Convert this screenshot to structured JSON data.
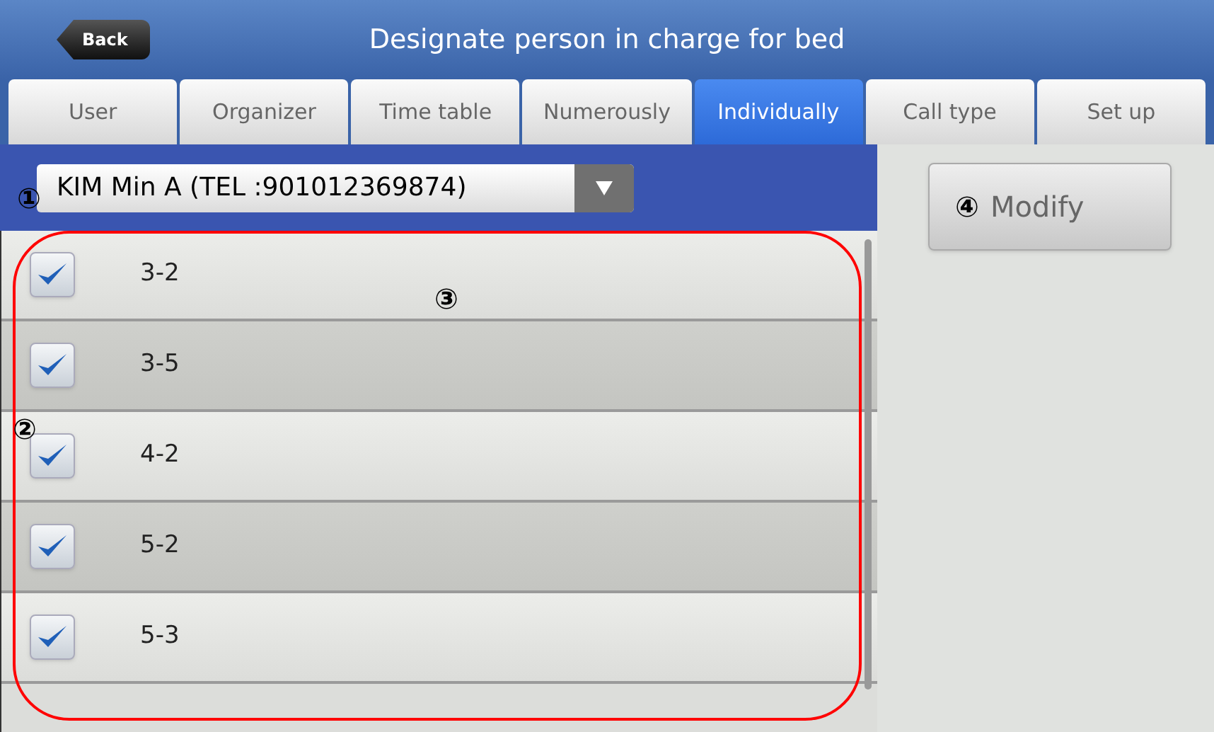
{
  "header": {
    "back_button": "Back",
    "title": "Designate person in charge for bed"
  },
  "tabs": [
    {
      "label": "User",
      "selected": false
    },
    {
      "label": "Organizer",
      "selected": false
    },
    {
      "label": "Time table",
      "selected": false
    },
    {
      "label": "Numerously",
      "selected": false
    },
    {
      "label": "Individually",
      "selected": true
    },
    {
      "label": "Call type",
      "selected": false
    },
    {
      "label": "Set up",
      "selected": false
    }
  ],
  "person_dropdown": {
    "value": "KIM Min A (TEL :901012369874)",
    "callout": "①"
  },
  "beds": [
    {
      "label": "3-2",
      "checked": true
    },
    {
      "label": "3-5",
      "checked": true
    },
    {
      "label": "4-2",
      "checked": true
    },
    {
      "label": "5-2",
      "checked": true
    },
    {
      "label": "5-3",
      "checked": true
    }
  ],
  "checkbox_callout": "②",
  "list_callout": "③",
  "modify_button": {
    "label": "Modify",
    "callout": "④"
  }
}
